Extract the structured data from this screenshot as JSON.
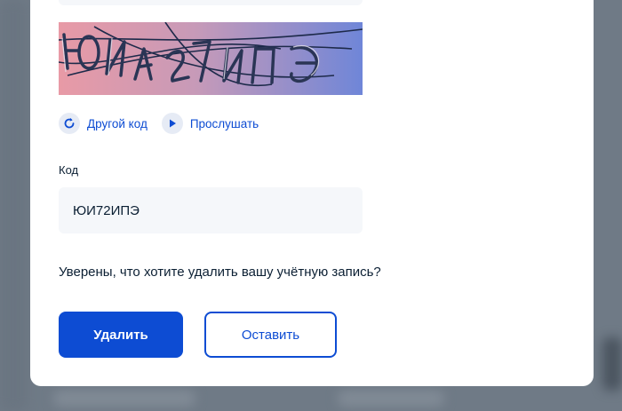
{
  "captcha": {
    "image_text": "ЮИ72ИПЭ",
    "refresh_label": "Другой код",
    "refresh_icon": "refresh-icon",
    "listen_label": "Прослушать",
    "listen_icon": "play-icon"
  },
  "code_field": {
    "label": "Код",
    "value": "ЮИ72ИПЭ"
  },
  "confirm": {
    "question": "Уверены, что хотите удалить вашу учётную запись?"
  },
  "buttons": {
    "delete_label": "Удалить",
    "keep_label": "Оставить"
  },
  "colors": {
    "primary": "#0d4cd3",
    "overlay": "#6f7a86",
    "input_bg": "#f5f7fa",
    "icon_bg": "#e6ebf5"
  }
}
